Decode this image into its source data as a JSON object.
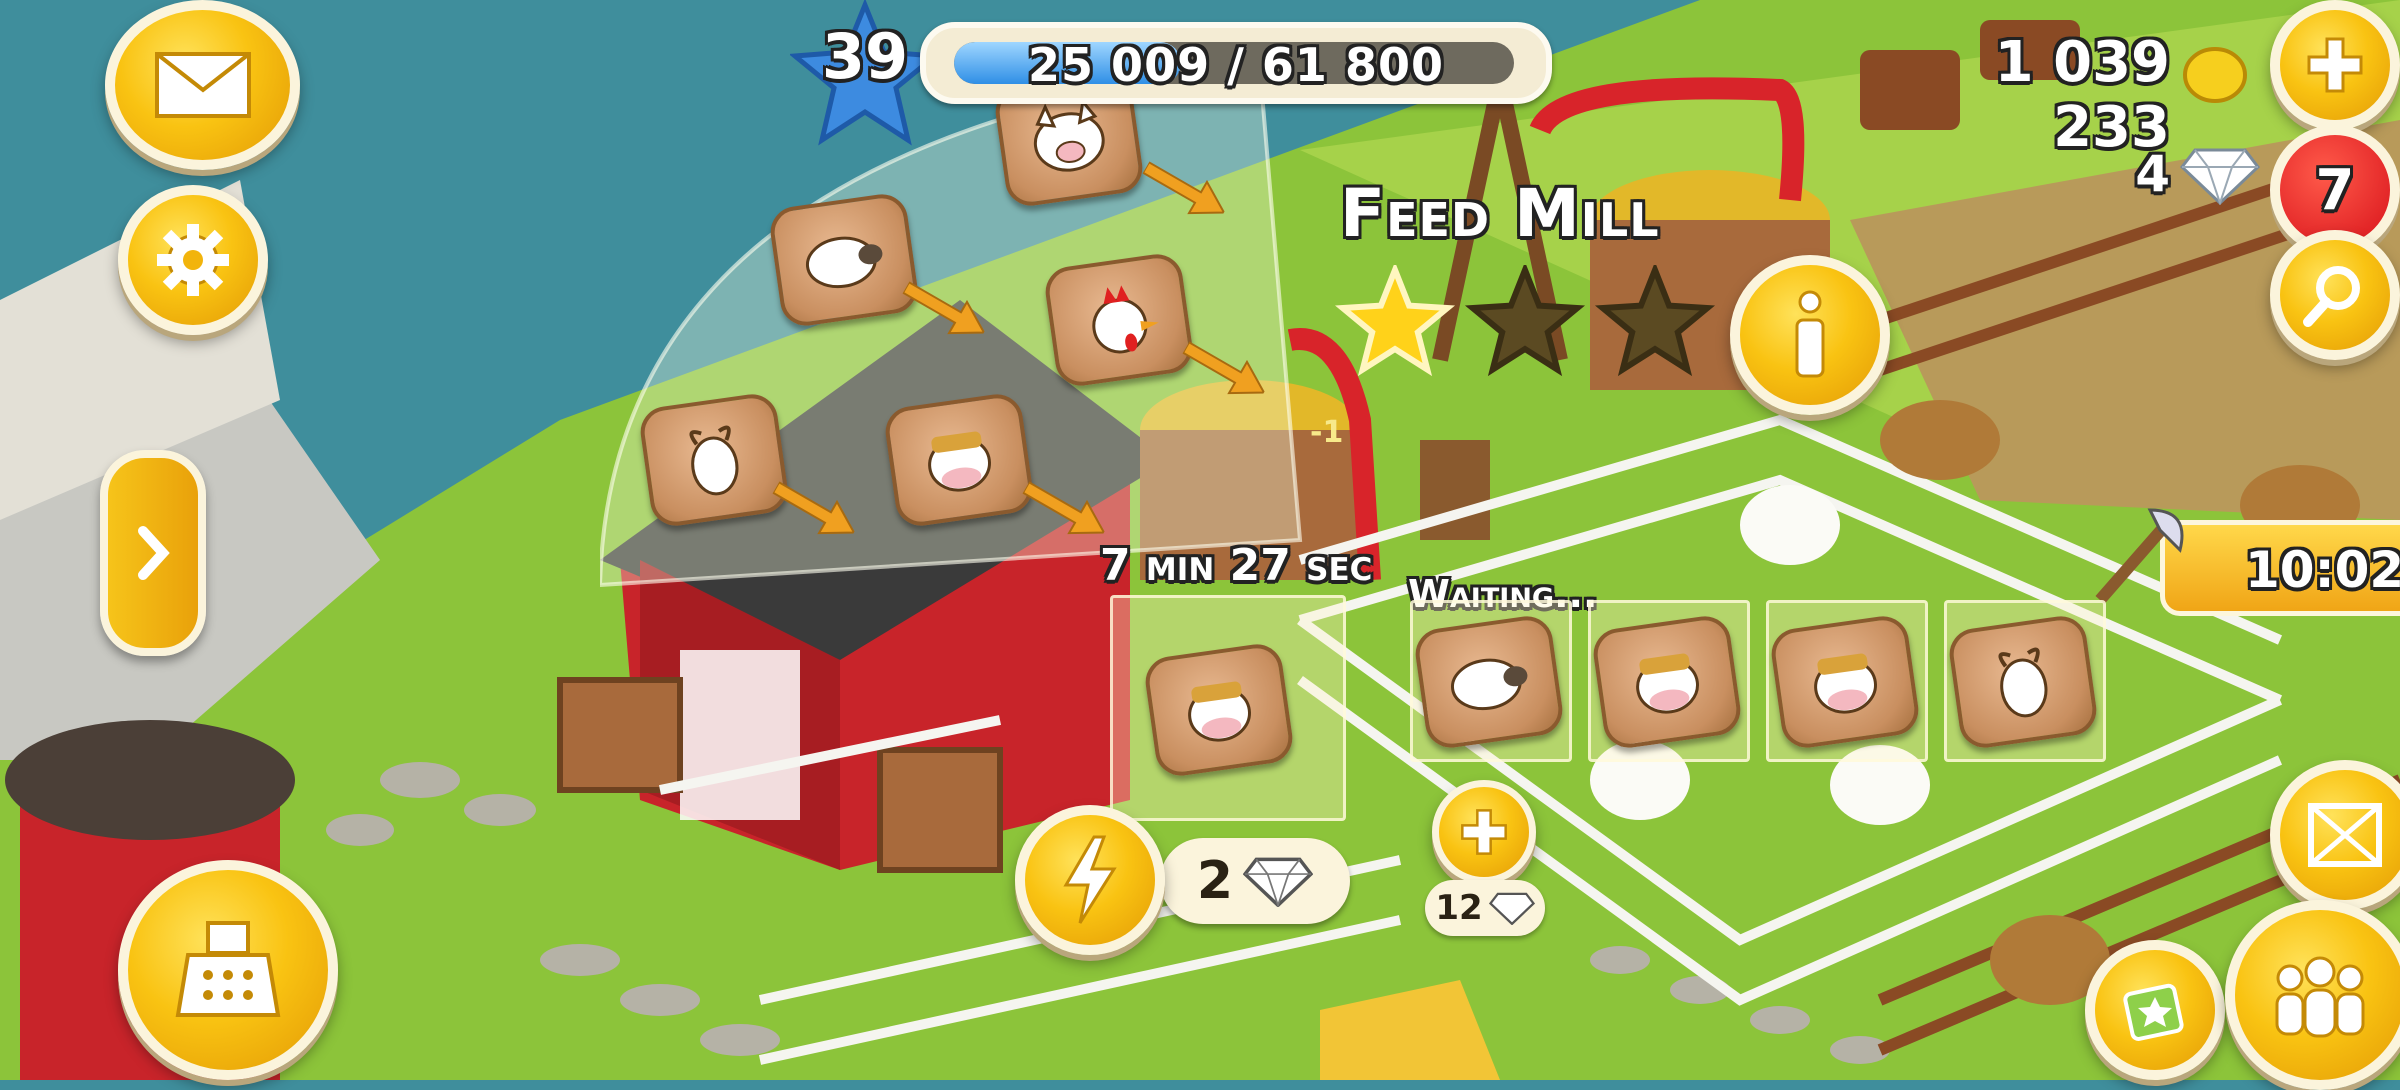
{
  "hud": {
    "level": "39",
    "xp_text": "25 009 / 61 800",
    "xp_progress": 0.405,
    "coins": "1 039 233",
    "diamonds": "4",
    "notification_count": "7",
    "timer_event": "10:02"
  },
  "building": {
    "name": "Feed Mill",
    "stars_filled": 1,
    "stars_total": 3,
    "timer": "7 min 27 sec",
    "waiting_label": "Waiting...",
    "speed_up_cost": "2",
    "add_slot_cost": "12",
    "production_minus": "-1"
  },
  "recipes": [
    {
      "icon": "pig-feed-icon"
    },
    {
      "icon": "sheep-feed-icon"
    },
    {
      "icon": "chicken-feed-icon"
    },
    {
      "icon": "goat-feed-icon"
    },
    {
      "icon": "cow-feed-icon"
    }
  ],
  "queue": [
    {
      "icon": "sheep-feed-icon"
    },
    {
      "icon": "cow-feed-icon"
    },
    {
      "icon": "cow-feed-icon"
    },
    {
      "icon": "goat-feed-icon"
    }
  ],
  "current_product": {
    "icon": "cow-feed-icon"
  },
  "colors": {
    "gold": "#f9c312",
    "water": "#3f8e9c",
    "grass": "#8cc43a",
    "barn_red": "#c8242a",
    "xp_blue": "#2f8fe6"
  }
}
